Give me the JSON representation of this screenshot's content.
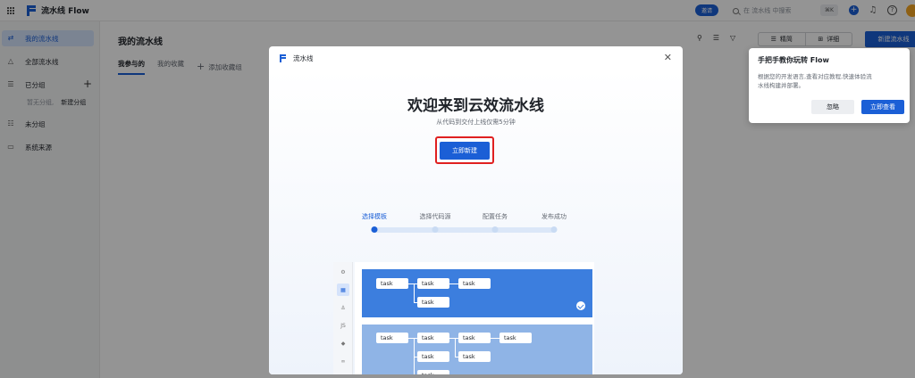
{
  "app": {
    "brand": "流水线 Flow"
  },
  "topbar": {
    "invite": "邀请",
    "search_placeholder": "在 流水线 中搜索",
    "shortcut": "⌘K"
  },
  "sidebar": {
    "items": [
      {
        "label": "我的流水线",
        "icon": "pipeline-icon"
      },
      {
        "label": "全部流水线",
        "icon": "triangle-icon"
      },
      {
        "label": "已分组",
        "icon": "list-icon"
      },
      {
        "label": "未分组",
        "icon": "ungrouped-icon"
      },
      {
        "label": "系统来源",
        "icon": "monitor-icon"
      }
    ],
    "group_hint": "暂无分组,",
    "group_new": "新建分组"
  },
  "main": {
    "title": "我的流水线",
    "tabs": [
      "我参与的",
      "我的收藏"
    ],
    "add_fav": "添加收藏组",
    "view_compact": "精简",
    "view_detail": "详细",
    "new_pipeline": "新建流水线"
  },
  "guide": {
    "title": "手把手教你玩转 Flow",
    "text": "根据您的开发语言,查看对应教程,快速体验流水线构建并部署。",
    "ignore": "忽略",
    "view_now": "立即查看"
  },
  "modal": {
    "header": "流水线",
    "title": "欢迎来到云效流水线",
    "subtitle": "从代码到交付上线仅需5分钟",
    "create_button": "立即新建",
    "steps": [
      "选择模板",
      "选择代码源",
      "配置任务",
      "发布成功"
    ],
    "active_step": 0,
    "preview_icons": [
      "⚙",
      "▦",
      "⚓",
      "JS",
      "◆",
      "∞",
      "⊕"
    ],
    "task_label": "task"
  }
}
